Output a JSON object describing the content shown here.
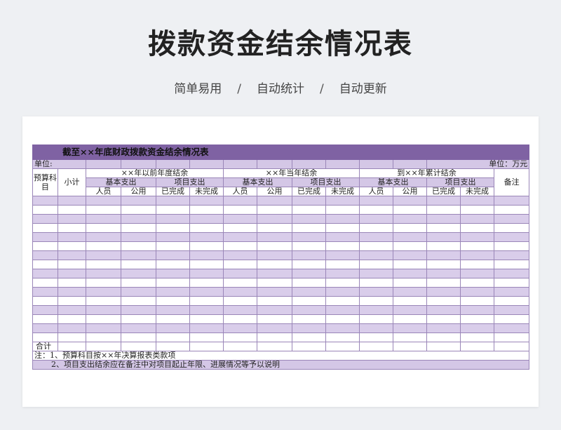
{
  "page": {
    "title": "拨款资金结余情况表",
    "tags": [
      "简单易用",
      "自动统计",
      "自动更新"
    ],
    "separator": "/"
  },
  "sheet": {
    "banner": "截至××年底财政拨款资金结余情况表",
    "unit_left": "单位:",
    "unit_right": "单位：万元",
    "col_subject": "预算科目",
    "col_subtotal": "小计",
    "group_prev": "××年以前年度结余",
    "group_curr": "××年当年结余",
    "group_cum": "到××年累计结余",
    "col_remark": "备注",
    "basic": "基本支出",
    "project": "项目支出",
    "staff": "人员",
    "public": "公用",
    "done": "已完成",
    "undone": "未完成",
    "total": "合计",
    "note1": "注：1、预算科目按××年决算报表类款项",
    "note2": "2、项目支出结余应在备注中对项目起止年限、进展情况等予以说明"
  },
  "colors": {
    "banner": "#7f62a3",
    "row_purple": "#d9cdea",
    "border": "#9a86b8"
  }
}
